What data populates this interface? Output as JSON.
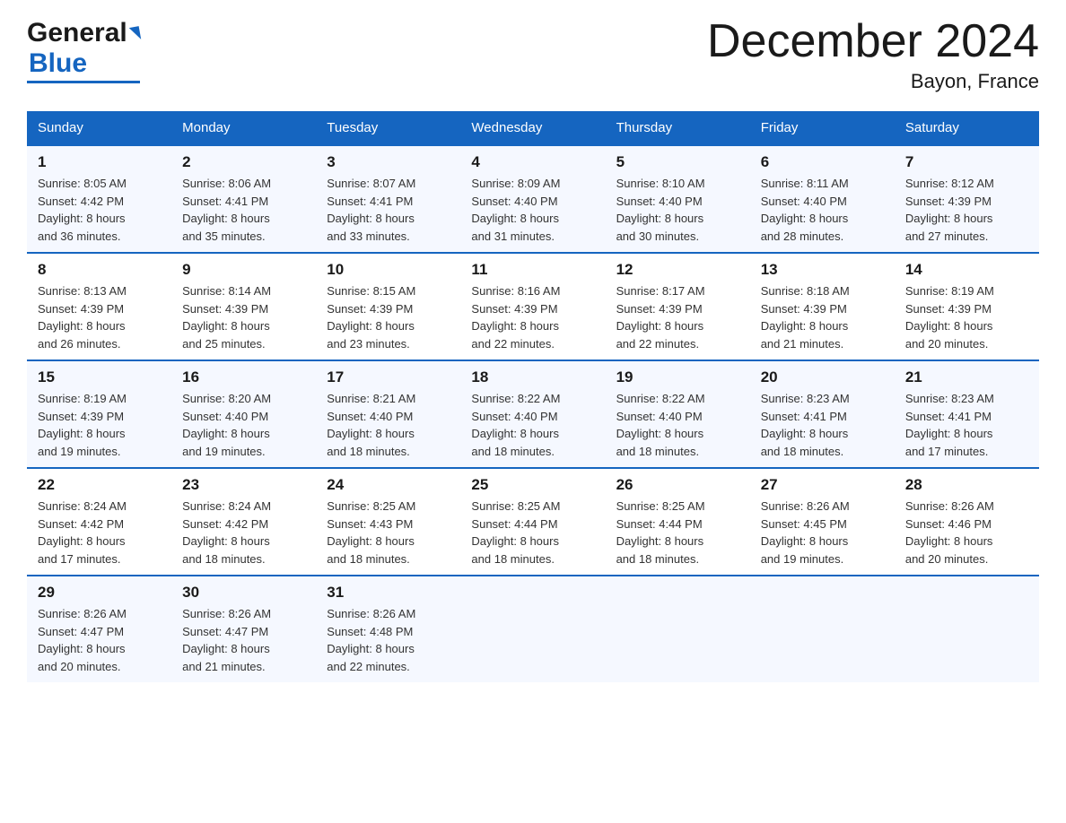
{
  "header": {
    "logo_general": "General",
    "logo_blue": "Blue",
    "month_title": "December 2024",
    "location": "Bayon, France"
  },
  "days_of_week": [
    "Sunday",
    "Monday",
    "Tuesday",
    "Wednesday",
    "Thursday",
    "Friday",
    "Saturday"
  ],
  "weeks": [
    [
      {
        "day": "1",
        "sunrise": "8:05 AM",
        "sunset": "4:42 PM",
        "daylight": "8 hours and 36 minutes."
      },
      {
        "day": "2",
        "sunrise": "8:06 AM",
        "sunset": "4:41 PM",
        "daylight": "8 hours and 35 minutes."
      },
      {
        "day": "3",
        "sunrise": "8:07 AM",
        "sunset": "4:41 PM",
        "daylight": "8 hours and 33 minutes."
      },
      {
        "day": "4",
        "sunrise": "8:09 AM",
        "sunset": "4:40 PM",
        "daylight": "8 hours and 31 minutes."
      },
      {
        "day": "5",
        "sunrise": "8:10 AM",
        "sunset": "4:40 PM",
        "daylight": "8 hours and 30 minutes."
      },
      {
        "day": "6",
        "sunrise": "8:11 AM",
        "sunset": "4:40 PM",
        "daylight": "8 hours and 28 minutes."
      },
      {
        "day": "7",
        "sunrise": "8:12 AM",
        "sunset": "4:39 PM",
        "daylight": "8 hours and 27 minutes."
      }
    ],
    [
      {
        "day": "8",
        "sunrise": "8:13 AM",
        "sunset": "4:39 PM",
        "daylight": "8 hours and 26 minutes."
      },
      {
        "day": "9",
        "sunrise": "8:14 AM",
        "sunset": "4:39 PM",
        "daylight": "8 hours and 25 minutes."
      },
      {
        "day": "10",
        "sunrise": "8:15 AM",
        "sunset": "4:39 PM",
        "daylight": "8 hours and 23 minutes."
      },
      {
        "day": "11",
        "sunrise": "8:16 AM",
        "sunset": "4:39 PM",
        "daylight": "8 hours and 22 minutes."
      },
      {
        "day": "12",
        "sunrise": "8:17 AM",
        "sunset": "4:39 PM",
        "daylight": "8 hours and 22 minutes."
      },
      {
        "day": "13",
        "sunrise": "8:18 AM",
        "sunset": "4:39 PM",
        "daylight": "8 hours and 21 minutes."
      },
      {
        "day": "14",
        "sunrise": "8:19 AM",
        "sunset": "4:39 PM",
        "daylight": "8 hours and 20 minutes."
      }
    ],
    [
      {
        "day": "15",
        "sunrise": "8:19 AM",
        "sunset": "4:39 PM",
        "daylight": "8 hours and 19 minutes."
      },
      {
        "day": "16",
        "sunrise": "8:20 AM",
        "sunset": "4:40 PM",
        "daylight": "8 hours and 19 minutes."
      },
      {
        "day": "17",
        "sunrise": "8:21 AM",
        "sunset": "4:40 PM",
        "daylight": "8 hours and 18 minutes."
      },
      {
        "day": "18",
        "sunrise": "8:22 AM",
        "sunset": "4:40 PM",
        "daylight": "8 hours and 18 minutes."
      },
      {
        "day": "19",
        "sunrise": "8:22 AM",
        "sunset": "4:40 PM",
        "daylight": "8 hours and 18 minutes."
      },
      {
        "day": "20",
        "sunrise": "8:23 AM",
        "sunset": "4:41 PM",
        "daylight": "8 hours and 18 minutes."
      },
      {
        "day": "21",
        "sunrise": "8:23 AM",
        "sunset": "4:41 PM",
        "daylight": "8 hours and 17 minutes."
      }
    ],
    [
      {
        "day": "22",
        "sunrise": "8:24 AM",
        "sunset": "4:42 PM",
        "daylight": "8 hours and 17 minutes."
      },
      {
        "day": "23",
        "sunrise": "8:24 AM",
        "sunset": "4:42 PM",
        "daylight": "8 hours and 18 minutes."
      },
      {
        "day": "24",
        "sunrise": "8:25 AM",
        "sunset": "4:43 PM",
        "daylight": "8 hours and 18 minutes."
      },
      {
        "day": "25",
        "sunrise": "8:25 AM",
        "sunset": "4:44 PM",
        "daylight": "8 hours and 18 minutes."
      },
      {
        "day": "26",
        "sunrise": "8:25 AM",
        "sunset": "4:44 PM",
        "daylight": "8 hours and 18 minutes."
      },
      {
        "day": "27",
        "sunrise": "8:26 AM",
        "sunset": "4:45 PM",
        "daylight": "8 hours and 19 minutes."
      },
      {
        "day": "28",
        "sunrise": "8:26 AM",
        "sunset": "4:46 PM",
        "daylight": "8 hours and 20 minutes."
      }
    ],
    [
      {
        "day": "29",
        "sunrise": "8:26 AM",
        "sunset": "4:47 PM",
        "daylight": "8 hours and 20 minutes."
      },
      {
        "day": "30",
        "sunrise": "8:26 AM",
        "sunset": "4:47 PM",
        "daylight": "8 hours and 21 minutes."
      },
      {
        "day": "31",
        "sunrise": "8:26 AM",
        "sunset": "4:48 PM",
        "daylight": "8 hours and 22 minutes."
      },
      null,
      null,
      null,
      null
    ]
  ],
  "labels": {
    "sunrise": "Sunrise:",
    "sunset": "Sunset:",
    "daylight": "Daylight:"
  }
}
